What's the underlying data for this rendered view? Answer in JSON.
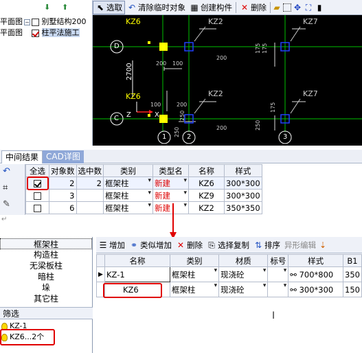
{
  "tree": {
    "rows": [
      {
        "prefix": "平面图",
        "label": "别墅结构200",
        "checked": false
      },
      {
        "prefix": "平面图",
        "label": "柱平法施工",
        "checked": true
      }
    ]
  },
  "toolbar": {
    "select": "选取",
    "clear_temp": "清除临时对象",
    "create_component": "创建构件",
    "delete": "删除"
  },
  "cad": {
    "col_labels": [
      "KZ6",
      "KZ2",
      "KZ7",
      "KZ6",
      "KZ2",
      "KZ7"
    ],
    "axis_rows": [
      "D",
      "C"
    ],
    "axis_cols": [
      "1",
      "2",
      "3"
    ],
    "dims": [
      "2700",
      "200",
      "100",
      "200",
      "175",
      "175",
      "250",
      "250",
      "200",
      "200",
      "100",
      "175",
      "250"
    ],
    "z_label": "Z",
    "x_label": "X"
  },
  "tabs": [
    "中间结果",
    "CAD详图"
  ],
  "grid1": {
    "headers": [
      "全选",
      "对象数",
      "选中数",
      "类别",
      "类型名",
      "名称",
      "样式"
    ],
    "rows": [
      {
        "checked": true,
        "count": "2",
        "selected": "2",
        "category": "框架柱",
        "type": "新建",
        "name": "KZ6",
        "style": "300*300"
      },
      {
        "checked": false,
        "count": "3",
        "selected": "",
        "category": "框架柱",
        "type": "新建",
        "name": "KZ9",
        "style": "300*300"
      },
      {
        "checked": false,
        "count": "6",
        "selected": "",
        "category": "框架柱",
        "type": "新建",
        "name": "KZ2",
        "style": "350*350"
      }
    ]
  },
  "type_list": [
    "框架柱",
    "构造柱",
    "无梁板柱",
    "暗柱",
    "垛",
    "其它柱"
  ],
  "filter": {
    "label": "筛选",
    "items": [
      "KZ-1",
      "KZ6...2个"
    ]
  },
  "toolbar2": {
    "add": "增加",
    "similar_add": "类似增加",
    "delete": "删除",
    "select_copy": "选择复制",
    "sort": "排序",
    "shape_edit": "异形编辑"
  },
  "grid2": {
    "headers": [
      "名称",
      "类别",
      "材质",
      "标号",
      "样式",
      "B1"
    ],
    "rows": [
      {
        "name": "KZ-1",
        "category": "框架柱",
        "material": "现浇砼",
        "grade": "",
        "style": "700*800",
        "b1": "350"
      },
      {
        "name": "KZ6",
        "category": "框架柱",
        "material": "现浇砼",
        "grade": "",
        "style": "300*300",
        "b1": "150"
      }
    ]
  },
  "colors": {
    "cad_bg": "#000000",
    "axis": "#00c000",
    "column_sel": "#ffff00",
    "column": "#2040ff",
    "highlight": "#e00000"
  }
}
